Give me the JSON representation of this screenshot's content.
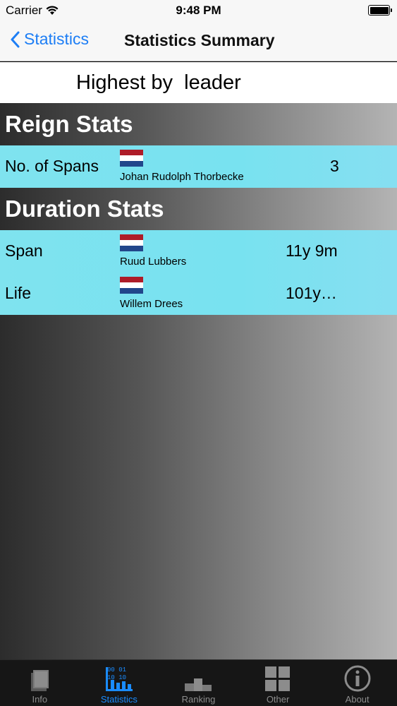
{
  "status_bar": {
    "carrier": "Carrier",
    "time": "9:48 PM"
  },
  "nav": {
    "back_label": "Statistics",
    "title": "Statistics Summary"
  },
  "subheader": {
    "text": "Highest by  leader"
  },
  "sections": [
    {
      "title": "Reign Stats",
      "rows": [
        {
          "label": "No. of Spans",
          "leader": "Johan Rudolph Thorbecke",
          "value": "3",
          "flag": "netherlands-flag-icon"
        }
      ]
    },
    {
      "title": "Duration Stats",
      "rows": [
        {
          "label": "Span",
          "leader": "Ruud Lubbers",
          "value": "11y 9m",
          "flag": "netherlands-flag-icon"
        },
        {
          "label": "Life",
          "leader": "Willem Drees",
          "value": "101y…",
          "flag": "netherlands-flag-icon"
        }
      ]
    }
  ],
  "tabs": [
    {
      "label": "Info",
      "icon": "book-icon",
      "active": false
    },
    {
      "label": "Statistics",
      "icon": "statistics-icon",
      "active": true
    },
    {
      "label": "Ranking",
      "icon": "podium-icon",
      "active": false
    },
    {
      "label": "Other",
      "icon": "grid-icon",
      "active": false
    },
    {
      "label": "About",
      "icon": "info-icon",
      "active": false
    }
  ],
  "colors": {
    "accent": "#1a8cff",
    "row_background": "#7fe3ef",
    "tab_inactive": "#8c8c8c"
  }
}
